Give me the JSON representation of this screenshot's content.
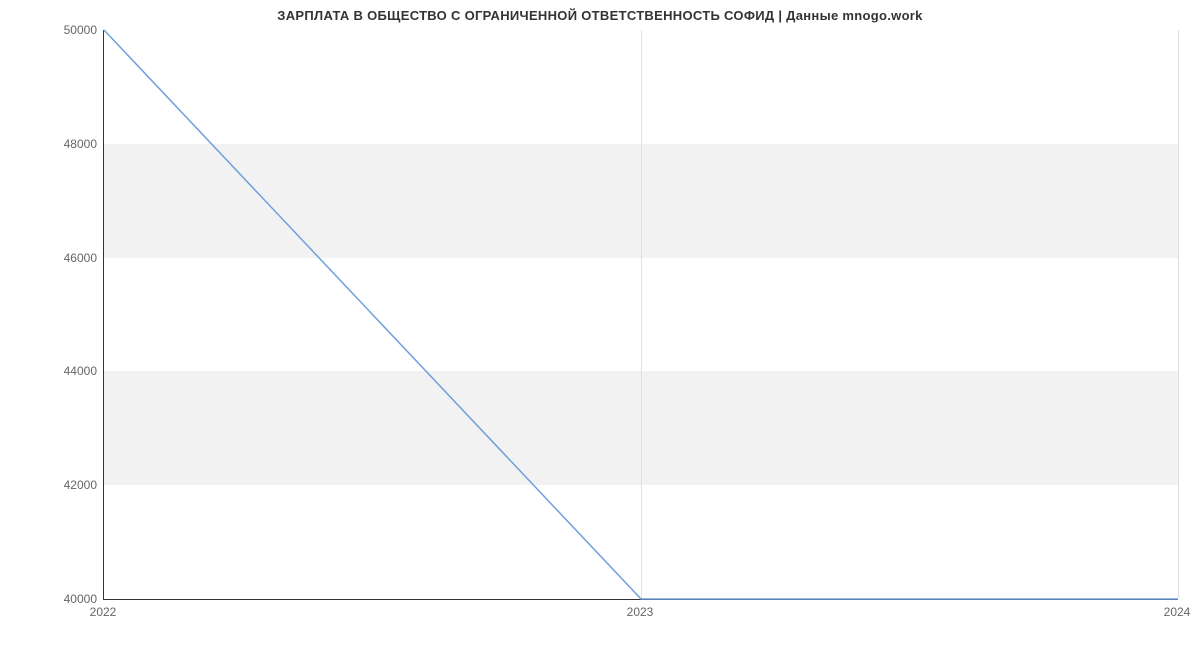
{
  "chart_data": {
    "type": "line",
    "title": "ЗАРПЛАТА В ОБЩЕСТВО С ОГРАНИЧЕННОЙ ОТВЕТСТВЕННОСТЬ СОФИД | Данные mnogo.work",
    "xlabel": "",
    "ylabel": "",
    "x_ticks": [
      "2022",
      "2023",
      "2024"
    ],
    "y_ticks": [
      40000,
      42000,
      44000,
      46000,
      48000,
      50000
    ],
    "ylim": [
      40000,
      50000
    ],
    "categories": [
      "2022",
      "2023",
      "2024"
    ],
    "values": [
      50000,
      40000,
      40000
    ]
  }
}
